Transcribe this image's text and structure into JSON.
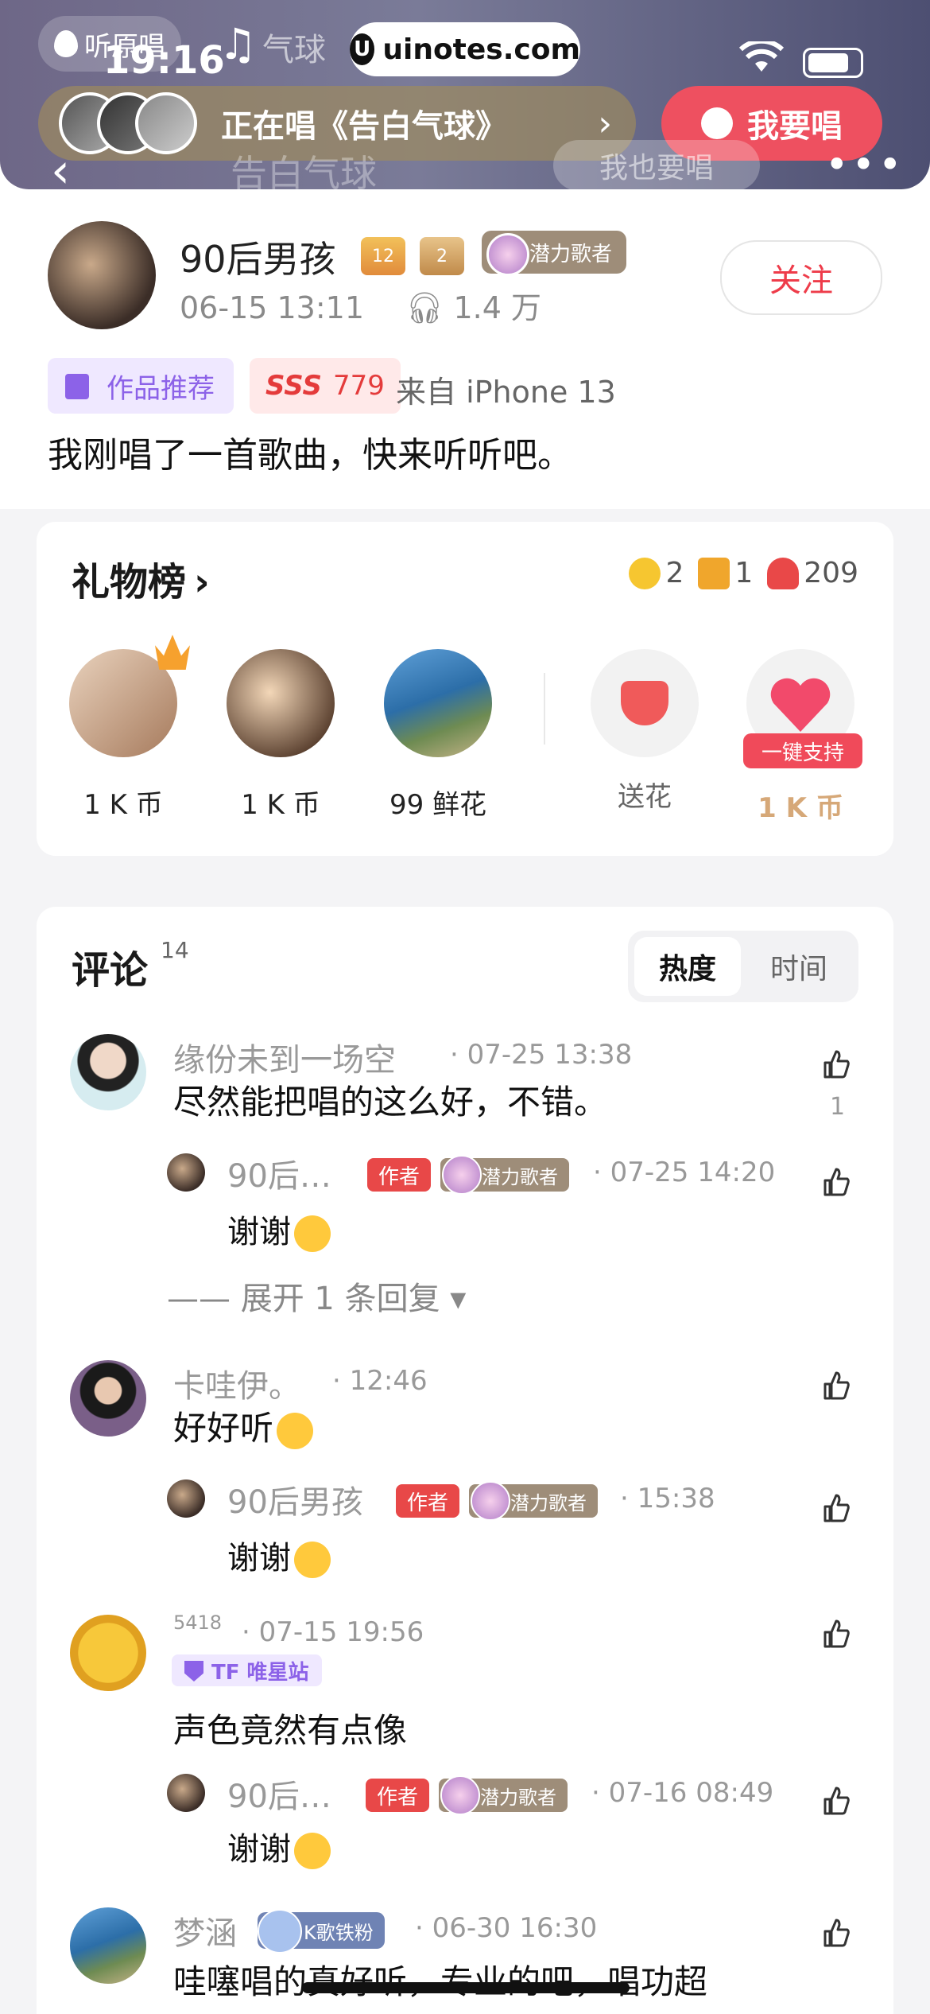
{
  "status_bar": {
    "time": "19:16",
    "listen_label": "听原唱",
    "faded_text": "气球",
    "watermark": "uinotes.com"
  },
  "top_bar": {
    "singing_text": "正在唱《告白气球》",
    "sing_button": "我要唱",
    "faded_song_title": "告白气球",
    "faded_sing_too": "我也要唱"
  },
  "post": {
    "author": "90后男孩",
    "level_badge_1": "12",
    "level_badge_2": "2",
    "potential_label": "潜力歌者",
    "date": "06-15 13:11",
    "plays": "1.4 万",
    "follow_label": "关注",
    "recommend_tag": "作品推荐",
    "score_grade": "SSS",
    "score_value": "779",
    "device": "来自 iPhone 13",
    "text": "我刚唱了一首歌曲，快来听听吧。"
  },
  "gifts": {
    "title": "礼物榜",
    "coin_count": "2",
    "chest_count": "1",
    "flower_count": "209",
    "givers": [
      {
        "label": "1 K 币"
      },
      {
        "label": "1 K 币"
      },
      {
        "label": "99 鲜花"
      }
    ],
    "send_flower": "送花",
    "support_badge": "一键支持",
    "support_amount": "1 K 币"
  },
  "comments": {
    "title": "评论",
    "count": "14",
    "sort_hot": "热度",
    "sort_time": "时间",
    "author_tag": "作者",
    "potential_tag": "潜力歌者",
    "items": [
      {
        "name": "缘份未到一场空",
        "date": "· 07-25 13:38",
        "text": "尽然能把唱的这么好，不错。",
        "likes": "1",
        "reply_name": "90后…",
        "reply_date": "· 07-25 14:20",
        "reply_text": "谢谢",
        "expand": "—— 展开 1 条回复 ▾"
      },
      {
        "name": "卡哇伊。",
        "date": "· 12:46",
        "text": "好好听",
        "reply_name": "90后男孩",
        "reply_date": "· 15:38",
        "reply_text": "谢谢"
      },
      {
        "name": "5418",
        "date": "· 07-15 19:56",
        "fan_tag": "TF 唯星站",
        "text": "声色竟然有点像",
        "reply_name": "90后…",
        "reply_date": "· 07-16 08:49",
        "reply_text": "谢谢"
      },
      {
        "name": "梦涵",
        "fan_tag": "K歌铁粉",
        "date": "· 06-30 16:30",
        "text": "哇噻唱的真好听，专业的吧，唱功超"
      }
    ]
  }
}
